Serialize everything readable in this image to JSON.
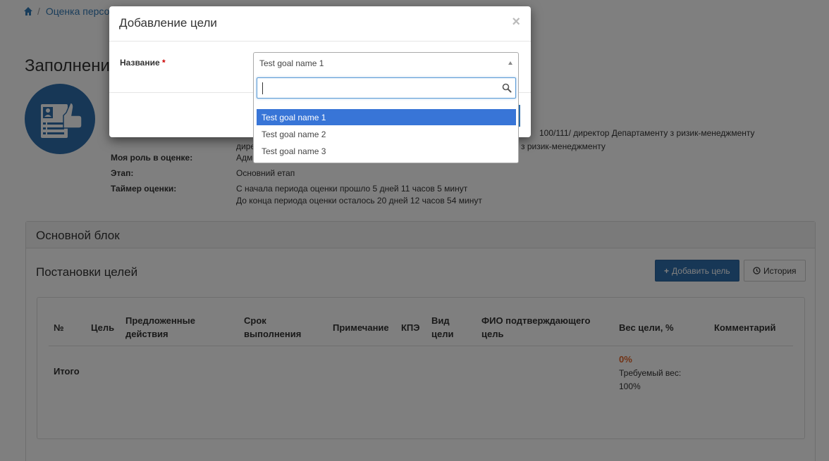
{
  "breadcrumb": {
    "crumb": "Оценка персо"
  },
  "page": {
    "title": "Заполнение"
  },
  "info": {
    "line1": "100/111/ директор Департаменту з ризик-менеджменту",
    "line2_prefix": "дире",
    "line2_suffix": "з ризик-менеджменту",
    "role_label": "Моя роль в оценке:",
    "role_value": "Адм",
    "stage_label": "Этап:",
    "stage_value": "Основний етап",
    "timer_label": "Таймер оценки:",
    "timer_line1": "С начала периода оценки прошло 5 дней 11 часов 5 минут",
    "timer_line2": "До конца периода оценки осталось 20 дней 12 часов 54 минут"
  },
  "panel": {
    "title": "Основной блок",
    "section": "Постановки целей",
    "add_button": "Добавить цель",
    "history_button": "История"
  },
  "table": {
    "headers": {
      "num": "№",
      "goal": "Цель",
      "actions_1": "Предложенные",
      "actions_2": "действия",
      "deadline_1": "Срок",
      "deadline_2": "выполнения",
      "note": "Примечание",
      "kpe": "КПЭ",
      "type_1": "Вид",
      "type_2": "цели",
      "fio_1": "ФИО подтверждающего",
      "fio_2": "цель",
      "weight": "Вес цели, %",
      "comment": "Комментарий"
    },
    "total_label": "Итого",
    "weight_value": "0%",
    "required_weight": "Требуемый вес: 100%"
  },
  "modal": {
    "title": "Добавление цели",
    "close": "×",
    "field_label": "Название",
    "required_mark": "*",
    "selected": "Test goal name 1",
    "search_value": "",
    "options": [
      "Test goal name 1",
      "Test goal name 2",
      "Test goal name 3"
    ]
  },
  "colors": {
    "primary": "#2f6fad",
    "highlight": "#3875d7",
    "warning": "#e5672a"
  }
}
